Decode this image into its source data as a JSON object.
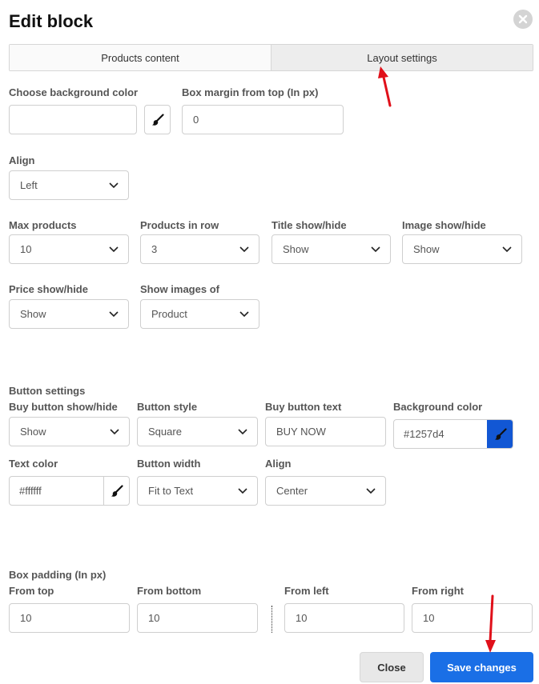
{
  "title": "Edit block",
  "tabs": [
    "Products content",
    "Layout settings"
  ],
  "labels": {
    "bg_color": "Choose background color",
    "box_margin": "Box margin from top (In px)",
    "align": "Align",
    "max_products": "Max products",
    "products_in_row": "Products in row",
    "title_show": "Title show/hide",
    "image_show": "Image show/hide",
    "price_show": "Price show/hide",
    "show_images_of": "Show images of",
    "button_settings": "Button settings",
    "buy_button_show": "Buy button show/hide",
    "button_style": "Button style",
    "buy_button_text": "Buy button text",
    "background_color": "Background color",
    "text_color": "Text color",
    "button_width": "Button width",
    "button_align": "Align",
    "box_padding": "Box padding (In px)",
    "from_top": "From top",
    "from_bottom": "From bottom",
    "from_left": "From left",
    "from_right": "From right"
  },
  "values": {
    "bg_color": "",
    "box_margin": "0",
    "align": "Left",
    "max_products": "10",
    "products_in_row": "3",
    "title_show": "Show",
    "image_show": "Show",
    "price_show": "Show",
    "show_images_of": "Product",
    "buy_button_show": "Show",
    "button_style": "Square",
    "buy_button_text": "BUY NOW",
    "background_color": "#1257d4",
    "text_color": "#ffffff",
    "button_width": "Fit to Text",
    "button_align": "Center",
    "from_top": "10",
    "from_bottom": "10",
    "from_left": "10",
    "from_right": "10"
  },
  "buttons": {
    "close": "Close",
    "save": "Save changes"
  },
  "icons": {
    "close": "close-circle-icon",
    "picker": "paint-brush-icon",
    "dropdown": "chevron-down-icon"
  },
  "colors": {
    "accent": "#1a6fe6",
    "swatch_blue": "#1257d4",
    "annotation": "#e0101a"
  }
}
